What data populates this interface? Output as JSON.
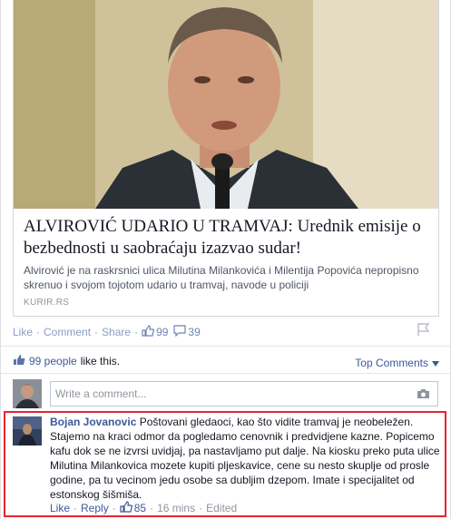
{
  "article": {
    "headline": "ALVIROVIĆ UDARIO U TRAMVAJ: Urednik emisije o bezbednosti u saobraćaju izazvao sudar!",
    "description": "Alvirović je na raskrsnici ulica Milutina Milankovića i Milentija Popovića nepropisno skrenuo i svojom tojotom udario u tramvaj, navode u policiji",
    "domain": "KURIR.RS",
    "image": "photo-older-man-speaking-at-microphone"
  },
  "actions": {
    "like": "Like",
    "comment": "Comment",
    "share": "Share",
    "likes_count": "99",
    "comments_count": "39",
    "sep": "·"
  },
  "social": {
    "people_count": "99 people",
    "like_this": "like this.",
    "top_comments": "Top Comments"
  },
  "composer": {
    "placeholder": "Write a comment..."
  },
  "comment": {
    "author": "Bojan Jovanovic",
    "text": "Poštovani gledaoci, kao što vidite tramvaj je neobeležen. Stajemo na kraci odmor da pogledamo cenovnik i predvidjene kazne. Popicemo kafu dok se ne izvrsi uvidjaj, pa nastavljamo put dalje. Na kiosku preko puta ulice Milutina Milankovica mozete kupiti pljeskavice, cene su nesto skuplje od prosle godine, pa tu vecinom jedu osobe sa dubljim dzepom. Imate i specijalitet od estonskog šišmiša.",
    "like": "Like",
    "reply": "Reply",
    "likes_count": "85",
    "time": "16 mins",
    "edited": "Edited"
  },
  "colors": {
    "link_blue": "#3b5998",
    "muted": "#90949c",
    "highlight_red": "#e3262e"
  }
}
